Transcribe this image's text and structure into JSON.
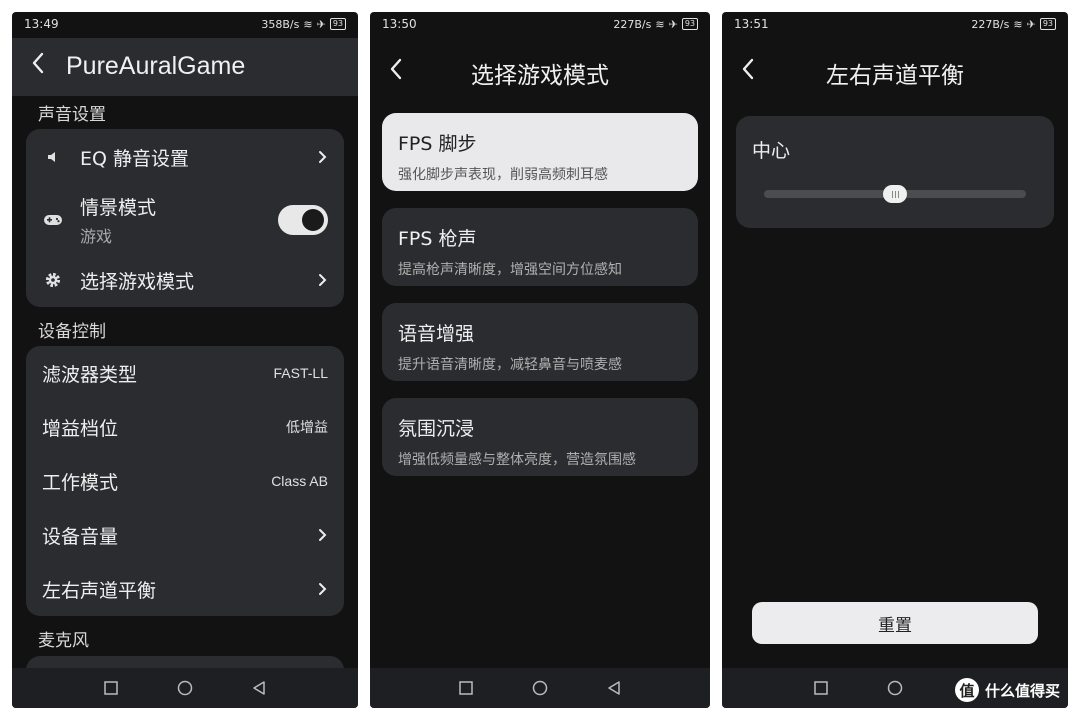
{
  "screen1": {
    "status": {
      "time": "13:49",
      "speed": "358B/s",
      "battery": "93"
    },
    "title": "PureAuralGame",
    "sections": [
      {
        "label": "声音设置"
      },
      {
        "label": "设备控制"
      },
      {
        "label": "麦克风"
      }
    ],
    "sound": {
      "eq": {
        "label": "EQ 静音设置",
        "icon": "speaker-icon"
      },
      "scene": {
        "label": "情景模式",
        "sub": "游戏",
        "icon": "gamepad-icon",
        "toggle_on": true
      },
      "game_mode": {
        "label": "选择游戏模式",
        "icon": "gear-icon"
      }
    },
    "device": [
      {
        "label": "滤波器类型",
        "value": "FAST-LL"
      },
      {
        "label": "增益档位",
        "value": "低增益"
      },
      {
        "label": "工作模式",
        "value": "Class AB"
      },
      {
        "label": "设备音量",
        "value": ""
      },
      {
        "label": "左右声道平衡",
        "value": ""
      }
    ]
  },
  "screen2": {
    "status": {
      "time": "13:50",
      "speed": "227B/s",
      "battery": "93"
    },
    "title": "选择游戏模式",
    "modes": [
      {
        "title": "FPS 脚步",
        "desc": "强化脚步声表现，削弱高频刺耳感",
        "selected": true
      },
      {
        "title": "FPS 枪声",
        "desc": "提高枪声清晰度，增强空间方位感知",
        "selected": false
      },
      {
        "title": "语音增强",
        "desc": "提升语音清晰度，减轻鼻音与喷麦感",
        "selected": false
      },
      {
        "title": "氛围沉浸",
        "desc": "增强低频量感与整体亮度，营造氛围感",
        "selected": false
      }
    ]
  },
  "screen3": {
    "status": {
      "time": "13:51",
      "speed": "227B/s",
      "battery": "93"
    },
    "title": "左右声道平衡",
    "balance_label": "中心",
    "balance_position": 0.5,
    "reset_label": "重置"
  },
  "watermark": {
    "mark": "值",
    "text": "什么值得买"
  },
  "colors": {
    "background": "#121212",
    "card": "#2a2c30",
    "selected_card": "#e9e9eb"
  }
}
